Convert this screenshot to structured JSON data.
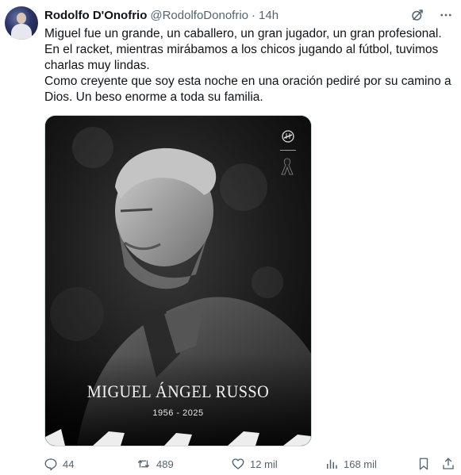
{
  "author": {
    "name": "Rodolfo D'Onofrio",
    "handle": "@RodolfoDonofrio",
    "separator": "·",
    "time": "14h"
  },
  "tweet": {
    "paragraphs": [
      "Miguel fue un grande, un caballero, un gran jugador, un gran profesional.",
      "En el racket, mientras mirábamos a los chicos jugando al fútbol, tuvimos charlas muy lindas.",
      "Como creyente que soy esta noche en una oración pediré por su camino a Dios. Un beso enorme a toda su familia."
    ]
  },
  "media": {
    "name": "MIGUEL ÁNGEL RUSSO",
    "years": "1956 - 2025",
    "logo_icon": "club-crest-icon",
    "ribbon_icon": "mourning-ribbon-icon"
  },
  "actions": {
    "replies": "44",
    "reposts": "489",
    "likes": "12 mil",
    "views": "168 mil"
  },
  "icons": {
    "header_left": "grok-icon",
    "header_right": "more-icon",
    "reply": "reply-icon",
    "repost": "repost-icon",
    "like": "heart-icon",
    "views": "views-icon",
    "bookmark": "bookmark-icon",
    "share": "share-icon"
  },
  "colors": {
    "text": "#0f1419",
    "secondary": "#536471",
    "border": "#cfd9de"
  }
}
